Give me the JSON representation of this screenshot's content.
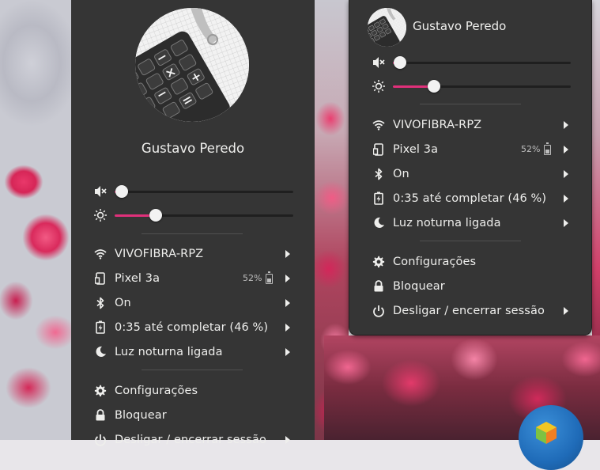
{
  "user": {
    "name": "Gustavo Peredo"
  },
  "sliders": {
    "volume": {
      "icon": "volume-muted-icon",
      "value": 0.04
    },
    "brightness": {
      "icon": "brightness-icon",
      "value": 0.23
    }
  },
  "menu": {
    "wifi": {
      "icon": "wifi-icon",
      "label": "VIVOFIBRA-RPZ"
    },
    "device": {
      "icon": "phone-icon",
      "label": "Pixel 3a",
      "battery_text": "52%"
    },
    "bluetooth": {
      "icon": "bluetooth-icon",
      "label": "On"
    },
    "power_status": {
      "icon": "battery-charging-icon",
      "label": "0:35 até completar (46 %)"
    },
    "night_light": {
      "icon": "moon-icon",
      "label": "Luz noturna ligada"
    },
    "settings": {
      "icon": "gear-icon",
      "label": "Configurações"
    },
    "lock": {
      "icon": "lock-icon",
      "label": "Bloquear"
    },
    "power_off": {
      "icon": "power-icon",
      "label": "Desligar / encerrar sessão"
    }
  },
  "colors": {
    "panel_bg": "#353535",
    "accent": "#e0307a",
    "text": "#eeeeec"
  }
}
